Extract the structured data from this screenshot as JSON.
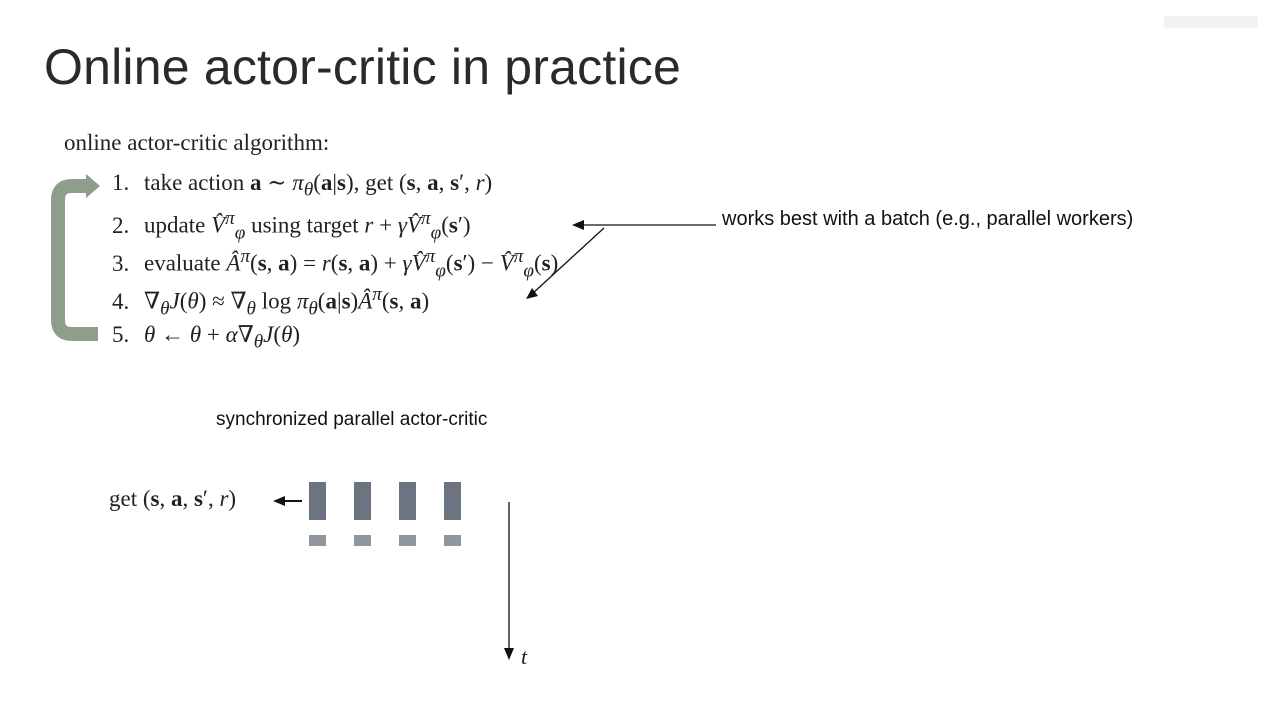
{
  "slide": {
    "title": "Online actor-critic in practice",
    "algorithm_heading": "online actor-critic algorithm:",
    "steps": [
      {
        "num": "1.",
        "text": "take action 𝐚 ∼ π_θ(𝐚|𝐬), get (𝐬, 𝐚, 𝐬′, r)"
      },
      {
        "num": "2.",
        "text": "update V̂^π_φ using target r + γV̂^π_φ(𝐬′)"
      },
      {
        "num": "3.",
        "text": "evaluate Â^π(𝐬, 𝐚) = r(𝐬, 𝐚) + γV̂^π_φ(𝐬′) − V̂^π_φ(𝐬)"
      },
      {
        "num": "4.",
        "text": "∇_θ J(θ) ≈ ∇_θ log π_θ(𝐚|𝐬) Â^π(𝐬, 𝐚)"
      },
      {
        "num": "5.",
        "text": "θ ← θ + α∇_θ J(θ)"
      }
    ],
    "callout": "works best with a batch (e.g., parallel workers)",
    "sync_label": "synchronized parallel actor-critic",
    "get_label": "get (𝐬, 𝐚, 𝐬′, r)",
    "time_label": "t",
    "worker_count": 4,
    "colors": {
      "loop_arrow": "#8f9e8a",
      "worker_bar": "#6b7480",
      "worker_small": "#8f969e"
    }
  }
}
